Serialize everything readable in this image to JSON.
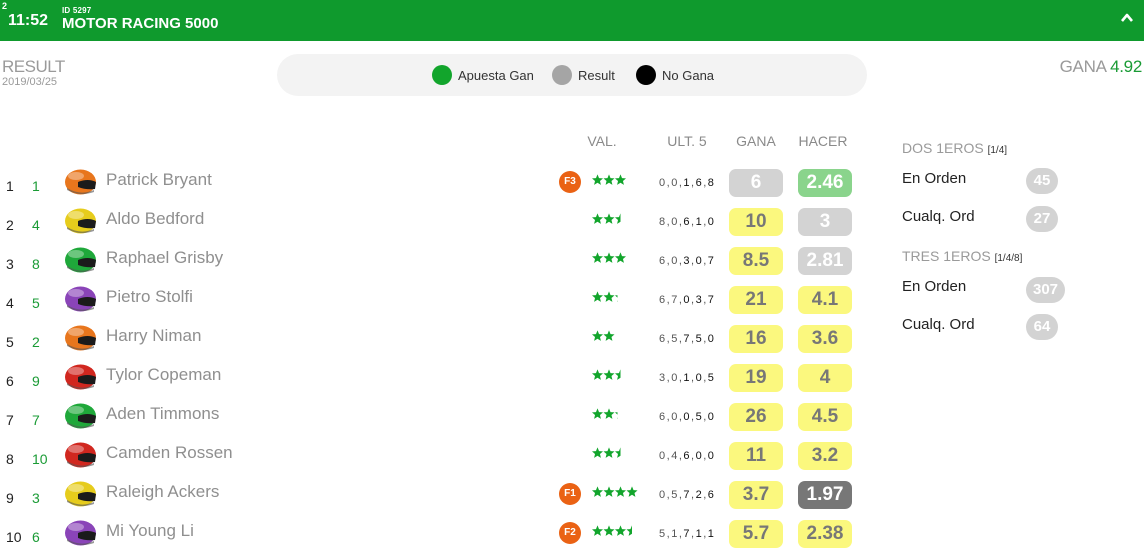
{
  "header": {
    "badge": "2",
    "time": "11:52",
    "race_id": "ID 5297",
    "title": "MOTOR RACING 5000"
  },
  "result": {
    "label": "RESULT",
    "date": "2019/03/25"
  },
  "legend": [
    {
      "label": "Apuesta Gan",
      "color": "#12a52c"
    },
    {
      "label": "Result",
      "color": "#a5a5a5"
    },
    {
      "label": "No Gana",
      "color": "#000000"
    }
  ],
  "gana_total": {
    "label": "GANA",
    "value": "4.92"
  },
  "columns": {
    "val": "VAL.",
    "ult5": "ULT. 5",
    "gana": "GANA",
    "hacer": "HACER"
  },
  "rows": [
    {
      "pos": "1",
      "num": "1",
      "name": "Patrick Bryant",
      "helmet": "orange",
      "badge": "F3",
      "stars": 3,
      "last5": [
        "0",
        "0",
        "1",
        "6",
        "8"
      ],
      "gana": "6",
      "gana_color": "grey",
      "hacer": "2.46",
      "hacer_color": "green"
    },
    {
      "pos": "2",
      "num": "4",
      "name": "Aldo Bedford",
      "helmet": "yellow",
      "badge": "",
      "stars": 2.5,
      "last5": [
        "8",
        "0",
        "6",
        "1",
        "0"
      ],
      "gana": "10",
      "gana_color": "yellow",
      "hacer": "3",
      "hacer_color": "grey"
    },
    {
      "pos": "3",
      "num": "8",
      "name": "Raphael Grisby",
      "helmet": "green",
      "badge": "",
      "stars": 3,
      "last5": [
        "6",
        "0",
        "3",
        "0",
        "7"
      ],
      "gana": "8.5",
      "gana_color": "yellow",
      "hacer": "2.81",
      "hacer_color": "grey"
    },
    {
      "pos": "4",
      "num": "5",
      "name": "Pietro Stolfi",
      "helmet": "purple",
      "badge": "",
      "stars": 2.25,
      "last5": [
        "6",
        "7",
        "0",
        "3",
        "7"
      ],
      "gana": "21",
      "gana_color": "yellow",
      "hacer": "4.1",
      "hacer_color": "yellow"
    },
    {
      "pos": "5",
      "num": "2",
      "name": "Harry Niman",
      "helmet": "orange",
      "badge": "",
      "stars": 2,
      "last5": [
        "6",
        "5",
        "7",
        "5",
        "0"
      ],
      "gana": "16",
      "gana_color": "yellow",
      "hacer": "3.6",
      "hacer_color": "yellow"
    },
    {
      "pos": "6",
      "num": "9",
      "name": "Tylor Copeman",
      "helmet": "red",
      "badge": "",
      "stars": 2.5,
      "last5": [
        "3",
        "0",
        "1",
        "0",
        "5"
      ],
      "gana": "19",
      "gana_color": "yellow",
      "hacer": "4",
      "hacer_color": "yellow"
    },
    {
      "pos": "7",
      "num": "7",
      "name": "Aden Timmons",
      "helmet": "green",
      "badge": "",
      "stars": 2.25,
      "last5": [
        "6",
        "0",
        "0",
        "5",
        "0"
      ],
      "gana": "26",
      "gana_color": "yellow",
      "hacer": "4.5",
      "hacer_color": "yellow"
    },
    {
      "pos": "8",
      "num": "10",
      "name": "Camden Rossen",
      "helmet": "red",
      "badge": "",
      "stars": 2.5,
      "last5": [
        "0",
        "4",
        "6",
        "0",
        "0"
      ],
      "gana": "11",
      "gana_color": "yellow",
      "hacer": "3.2",
      "hacer_color": "yellow"
    },
    {
      "pos": "9",
      "num": "3",
      "name": "Raleigh Ackers",
      "helmet": "yellow",
      "badge": "F1",
      "stars": 4,
      "last5": [
        "0",
        "5",
        "7",
        "2",
        "6"
      ],
      "gana": "3.7",
      "gana_color": "yellow",
      "hacer": "1.97",
      "hacer_color": "dark"
    },
    {
      "pos": "10",
      "num": "6",
      "name": "Mi Young Li",
      "helmet": "purple",
      "badge": "F2",
      "stars": 3.5,
      "last5": [
        "5",
        "1",
        "7",
        "1",
        "1"
      ],
      "gana": "5.7",
      "gana_color": "yellow",
      "hacer": "2.38",
      "hacer_color": "yellow"
    }
  ],
  "right_panel": {
    "dos_title": "DOS 1EROS",
    "dos_sub": "[1/4]",
    "dos_rows": [
      {
        "label": "En Orden",
        "value": "45"
      },
      {
        "label": "Cualq. Ord",
        "value": "27"
      }
    ],
    "tres_title": "TRES 1EROS",
    "tres_sub": "[1/4/8]",
    "tres_rows": [
      {
        "label": "En Orden",
        "value": "307"
      },
      {
        "label": "Cualq. Ord",
        "value": "64"
      }
    ]
  },
  "colors": {
    "header_green": "#0f9a2d",
    "number_green": "#1a9b35",
    "odds_yellow": "#fbf87e",
    "odds_grey": "#d3d3d3",
    "odds_green": "#8ad48c",
    "odds_dark": "#777777",
    "badge_orange": "#ea6214",
    "helmets": {
      "orange": "#e8761d",
      "yellow": "#e6cc1c",
      "green": "#1fa83a",
      "purple": "#8a44b8",
      "red": "#d1271f"
    }
  }
}
